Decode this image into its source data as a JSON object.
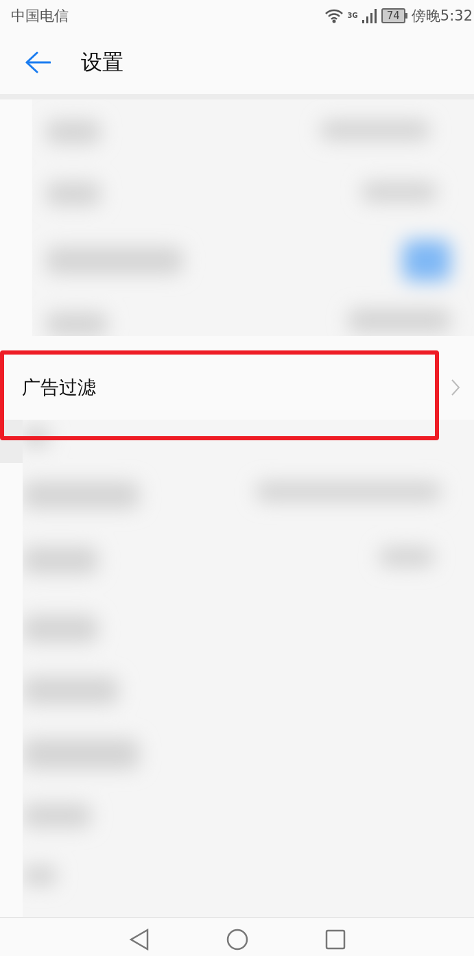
{
  "status_bar": {
    "carrier": "中国电信",
    "network": "3G",
    "battery": "74",
    "time": "傍晚5:32"
  },
  "header": {
    "title": "设置"
  },
  "settings": [
    {
      "label": "广告过滤",
      "highlighted": true
    }
  ]
}
